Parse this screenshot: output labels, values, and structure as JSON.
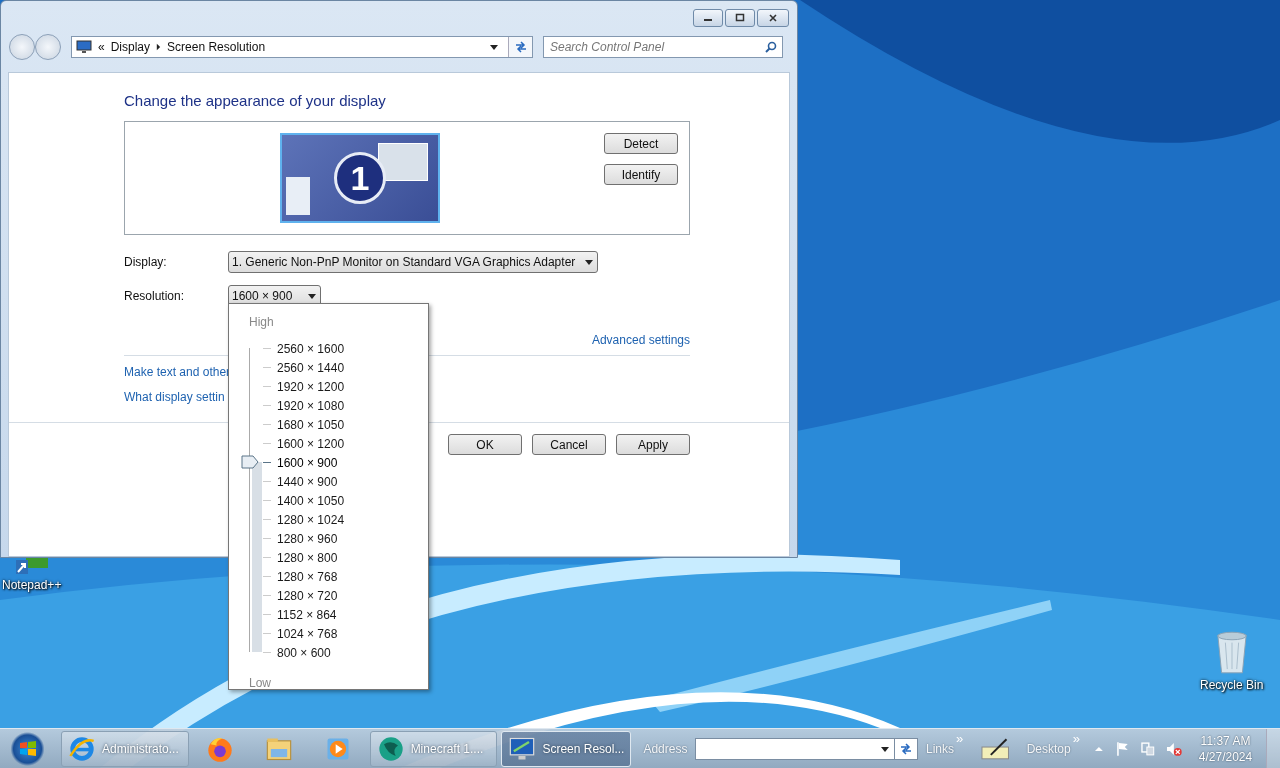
{
  "window": {
    "nav": {
      "prefix": "«",
      "breadcrumb": [
        "Display",
        "Screen Resolution"
      ]
    },
    "search": {
      "placeholder": "Search Control Panel"
    },
    "heading": "Change the appearance of your display",
    "monitor": {
      "number": "1"
    },
    "side_buttons": [
      "Detect",
      "Identify"
    ],
    "display": {
      "label": "Display:",
      "value": "1. Generic Non-PnP Monitor on Standard VGA Graphics Adapter"
    },
    "resolution": {
      "label": "Resolution:",
      "value": "1600 × 900"
    },
    "advanced_link": "Advanced settings",
    "links": [
      "Make text and other",
      "What display settin"
    ],
    "buttons": [
      "OK",
      "Cancel",
      "Apply"
    ]
  },
  "resolution_popup": {
    "high_label": "High",
    "low_label": "Low",
    "slider": {
      "level": 0.625
    },
    "options": [
      {
        "label": "2560 × 1600",
        "selected": false
      },
      {
        "label": "2560 × 1440",
        "selected": false
      },
      {
        "label": "1920 × 1200",
        "selected": false
      },
      {
        "label": "1920 × 1080",
        "selected": false
      },
      {
        "label": "1680 × 1050",
        "selected": false
      },
      {
        "label": "1600 × 1200",
        "selected": false
      },
      {
        "label": "1600 × 900",
        "selected": true
      },
      {
        "label": "1440 × 900",
        "selected": false
      },
      {
        "label": "1400 × 1050",
        "selected": false
      },
      {
        "label": "1280 × 1024",
        "selected": false
      },
      {
        "label": "1280 × 960",
        "selected": false
      },
      {
        "label": "1280 × 800",
        "selected": false
      },
      {
        "label": "1280 × 768",
        "selected": false
      },
      {
        "label": "1280 × 720",
        "selected": false
      },
      {
        "label": "1152 × 864",
        "selected": false
      },
      {
        "label": "1024 × 768",
        "selected": false
      },
      {
        "label": "800 × 600",
        "selected": false
      }
    ]
  },
  "desktop_icons": [
    {
      "label": "Notepad++",
      "kind": "shortcut"
    },
    {
      "label": "Recycle Bin",
      "kind": "bin"
    }
  ],
  "taskbar": {
    "items": [
      {
        "kind": "ie",
        "label": "Administrato...",
        "selected": false
      },
      {
        "kind": "firefox"
      },
      {
        "kind": "folder"
      },
      {
        "kind": "media"
      },
      {
        "kind": "globe",
        "label": "Minecraft 1....",
        "selected": false
      },
      {
        "kind": "monitor",
        "label": "Screen Resol...",
        "selected": true
      }
    ],
    "address_label": "Address",
    "links_label": "Links",
    "links_chevron": "»",
    "desktop_label": "Desktop",
    "desktop_chevron": "»",
    "time": "11:37 AM",
    "date": "4/27/2024"
  }
}
